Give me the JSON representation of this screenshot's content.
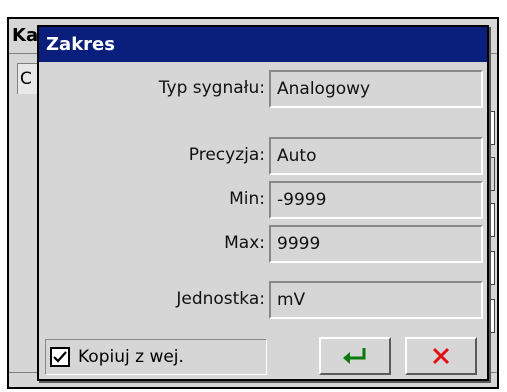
{
  "background_window": {
    "title": "Ka",
    "tab_label": "C"
  },
  "dialog": {
    "title": "Zakres",
    "fields": [
      {
        "label": "Typ sygnału:",
        "value": "Analogowy"
      },
      {
        "label": "Precyzja:",
        "value": "Auto"
      },
      {
        "label": "Min:",
        "value": "-9999"
      },
      {
        "label": "Max:",
        "value": "9999"
      },
      {
        "label": "Jednostka:",
        "value": "mV"
      }
    ],
    "copy_checkbox": {
      "label": "Kopiuj z wej.",
      "checked": true
    },
    "ok_button": {
      "icon": "enter-arrow-icon",
      "color": "#0a7a0a"
    },
    "cancel_button": {
      "icon": "close-x-icon",
      "color": "#e01010"
    }
  }
}
